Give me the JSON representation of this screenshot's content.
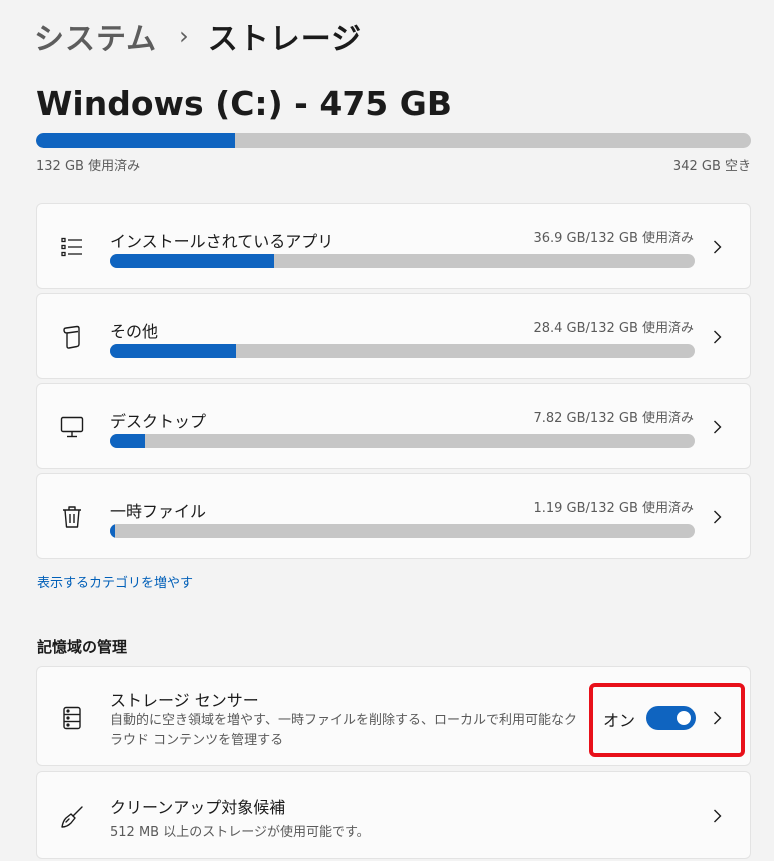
{
  "breadcrumb": {
    "parent": "システム",
    "separator": "›",
    "current": "ストレージ"
  },
  "drive": {
    "title": "Windows (C:) - 475 GB",
    "used_text": "132 GB 使用済み",
    "free_text": "342 GB 空き",
    "used_fraction": 0.278
  },
  "categories": [
    {
      "label": "インストールされているアプリ",
      "usage": "36.9 GB/132 GB 使用済み",
      "fraction": 0.2795,
      "icon": "apps-list-icon"
    },
    {
      "label": "その他",
      "usage": "28.4 GB/132 GB 使用済み",
      "fraction": 0.2152,
      "icon": "other-files-icon"
    },
    {
      "label": "デスクトップ",
      "usage": "7.82 GB/132 GB 使用済み",
      "fraction": 0.0592,
      "icon": "desktop-icon"
    },
    {
      "label": "一時ファイル",
      "usage": "1.19 GB/132 GB 使用済み",
      "fraction": 0.009,
      "icon": "trash-icon"
    }
  ],
  "more_categories_link": "表示するカテゴリを増やす",
  "storage_management": {
    "title": "記憶域の管理",
    "storage_sense": {
      "label": "ストレージ センサー",
      "description": "自動的に空き領域を増やす、一時ファイルを削除する、ローカルで利用可能なクラウド コンテンツを管理する",
      "toggle_state": "オン",
      "toggle_on": true,
      "icon": "storage-drive-icon"
    },
    "cleanup": {
      "label": "クリーンアップ対象候補",
      "description": "512 MB 以上のストレージが使用可能です。",
      "icon": "broom-icon"
    }
  },
  "colors": {
    "accent": "#0f64c0",
    "highlight": "#e8101a"
  }
}
